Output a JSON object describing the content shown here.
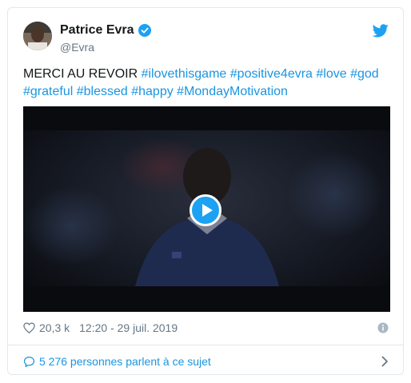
{
  "user": {
    "name": "Patrice Evra",
    "handle": "@Evra"
  },
  "tweet": {
    "lead": "MERCI AU REVOIR ",
    "hashtags": [
      "#ilovethisgame",
      "#positive4evra",
      "#love",
      "#god",
      "#grateful",
      "#blessed",
      "#happy",
      "#MondayMotivation"
    ]
  },
  "meta": {
    "likes": "20,3 k",
    "timestamp": "12:20 - 29 juil. 2019"
  },
  "footer": {
    "conversation": "5 276 personnes parlent à ce sujet"
  },
  "colors": {
    "link": "#1b95e0",
    "text": "#14171a",
    "muted": "#657786"
  },
  "icons": {
    "verified": "verified-badge-icon",
    "bird": "twitter-bird-icon",
    "play": "play-icon",
    "heart": "heart-icon",
    "info": "info-icon",
    "bubble": "speech-bubble-icon",
    "chevron": "chevron-right-icon"
  }
}
